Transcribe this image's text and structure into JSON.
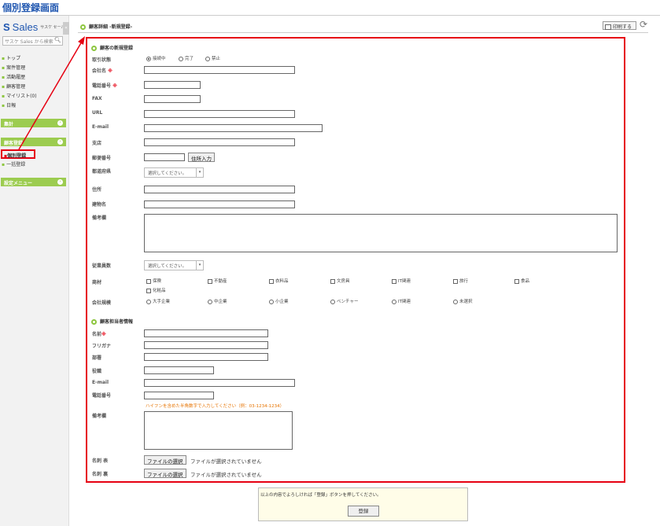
{
  "page_heading": "個別登録画面",
  "app": {
    "logo_text": "Sales",
    "logo_sub": "サスケ セールス",
    "collapse_glyph": "«"
  },
  "sidebar": {
    "search_placeholder": "サスケ Sales から検索",
    "items": [
      {
        "label": "トップ"
      },
      {
        "label": "案件管理"
      },
      {
        "label": "活動履歴"
      },
      {
        "label": "顧客管理"
      },
      {
        "label": "マイリスト(0)"
      },
      {
        "label": "日報"
      }
    ],
    "section_shukei": "集計",
    "section_kokyaku": "顧客登録",
    "sub_items": [
      {
        "label": "個別登録"
      },
      {
        "label": "一括登録"
      }
    ],
    "section_settings": "設定メニュー"
  },
  "header": {
    "title": "顧客詳細 -新規登録-",
    "print_label": "印刷する"
  },
  "form": {
    "section1_title": "顧客の新規登録",
    "labels": {
      "status": "取引状態",
      "company": "会社名",
      "phone": "電話番号",
      "fax": "FAX",
      "url": "URL",
      "email": "E-mail",
      "branch": "支店",
      "zip": "郵便番号",
      "prefecture": "都道府県",
      "address": "住所",
      "building": "建物名",
      "remarks": "備考欄",
      "employees": "従業員数",
      "products": "商材",
      "size": "会社規模"
    },
    "required_mark": "※",
    "status_options": [
      "接続中",
      "完了",
      "禁止"
    ],
    "zip_button": "住所入力",
    "select_placeholder": "選択してください。",
    "product_options": [
      "保険",
      "不動産",
      "衣料品",
      "文房具",
      "IT関連",
      "旅行",
      "食品",
      "化粧品"
    ],
    "size_options": [
      "大手企業",
      "中企業",
      "小企業",
      "ベンチャー",
      "IT関連",
      "未選択"
    ],
    "section2_title": "顧客担当者情報",
    "contact_labels": {
      "name": "名前",
      "kana": "フリガナ",
      "department": "部署",
      "position": "役職",
      "email": "E-mail",
      "phone": "電話番号",
      "remarks": "備考欄",
      "card_front": "名刺 表",
      "card_back": "名刺 裏"
    },
    "phone_hint": "ハイフンを含めた半角数字で入力してください（例：03-1234-1234）",
    "file_button": "ファイルの選択",
    "file_status": "ファイルが選択されていません"
  },
  "confirm": {
    "message": "以上の内容でよろしければ「登録」ボタンを押してください。",
    "register_label": "登録"
  },
  "colors": {
    "accent": "#8dc63f",
    "highlight": "#e60012",
    "heading": "#1f56b0"
  }
}
